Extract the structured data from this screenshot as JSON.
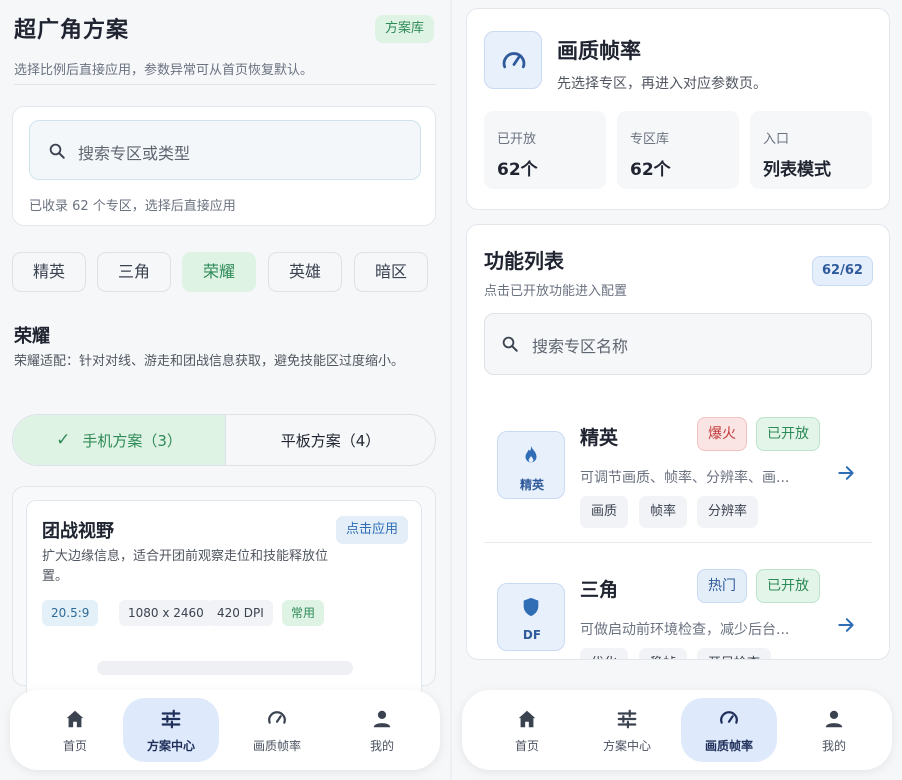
{
  "left": {
    "title": "超广角方案",
    "badge": "方案库",
    "subtitle": "选择比例后直接应用，参数异常可从首页恢复默认。",
    "search": {
      "placeholder": "搜索专区或类型",
      "count_text": "已收录 62 个专区，选择后直接应用"
    },
    "chips": [
      {
        "label": "精英",
        "active": false
      },
      {
        "label": "三角",
        "active": false
      },
      {
        "label": "荣耀",
        "active": true
      },
      {
        "label": "英雄",
        "active": false
      },
      {
        "label": "暗区",
        "active": false
      }
    ],
    "section": {
      "title": "荣耀",
      "desc": "荣耀适配：针对对线、游走和团战信息获取，避免技能区过度缩小。"
    },
    "segment": {
      "phone": "手机方案（3）",
      "tablet": "平板方案（4）",
      "selected": "phone"
    },
    "scheme": {
      "title": "团战视野",
      "apply": "点击应用",
      "desc": "扩大边缘信息，适合开团前观察走位和技能释放位置。",
      "tags": [
        "20.5:9",
        "1080 x 2460",
        "420 DPI",
        "常用"
      ]
    },
    "nav": {
      "items": [
        "首页",
        "方案中心",
        "画质帧率",
        "我的"
      ],
      "active": 1
    }
  },
  "right": {
    "header": {
      "title": "画质帧率",
      "subtitle": "先选择专区，再进入对应参数页。",
      "stats": [
        {
          "label": "已开放",
          "value": "62个"
        },
        {
          "label": "专区库",
          "value": "62个"
        },
        {
          "label": "入口",
          "value": "列表模式"
        }
      ]
    },
    "features": {
      "title": "功能列表",
      "subtitle": "点击已开放功能进入配置",
      "count": "62/62",
      "search_placeholder": "搜索专区名称",
      "items": [
        {
          "name": "精英",
          "icon_label": "精英",
          "icon": "flame-icon",
          "badge": "爆火",
          "status": "已开放",
          "desc": "可调节画质、帧率、分辨率、画...",
          "tags": [
            "画质",
            "帧率",
            "分辨率"
          ]
        },
        {
          "name": "三角",
          "icon_label": "DF",
          "icon": "shield-icon",
          "badge": "热门",
          "status": "已开放",
          "desc": "可做启动前环境检查，减少后台...",
          "tags": [
            "优化",
            "稳帧",
            "开局检查"
          ]
        }
      ]
    },
    "nav": {
      "items": [
        "首页",
        "方案中心",
        "画质帧率",
        "我的"
      ],
      "active": 2
    }
  },
  "colors": {
    "accent_green": "#2e8b57",
    "accent_blue": "#2f5a9b",
    "hot_red": "#c43a3a",
    "nav_active_bg": "#dee9fb"
  }
}
